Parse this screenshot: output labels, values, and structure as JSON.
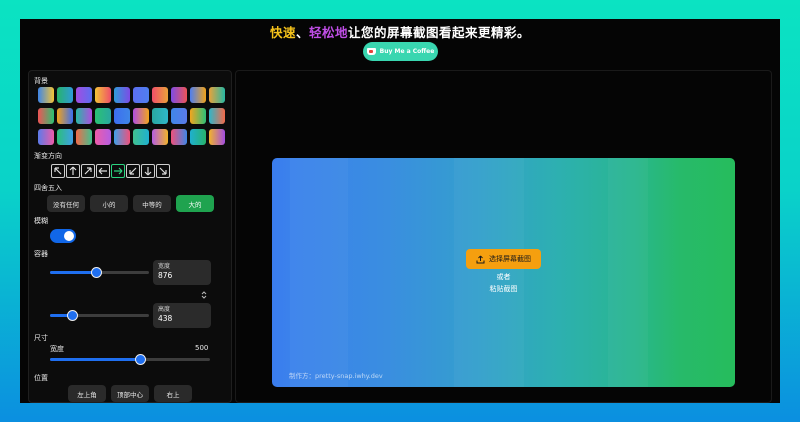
{
  "header": {
    "title_part1": "快速",
    "title_sep": "、",
    "title_part2": "轻松地",
    "title_rest": "让您的屏幕截图看起来更精彩。",
    "bmc_label": "Buy Me a Coffee"
  },
  "sidebar": {
    "background_label": "背景",
    "swatches": [
      "#3f86e7",
      "#27b36b",
      "#a34de2",
      "#f4c437",
      "#2f9bd9",
      "#5c6ef0",
      "#ef4f6a",
      "#7d4ce6",
      "#4f7ff0",
      "#e9a23a",
      "#ef5455",
      "#f1a31a",
      "#27b8a4",
      "#2ac273",
      "#3c6ef0",
      "#b04ee0",
      "#29a7a0",
      "#3f86e7",
      "#f2a51e",
      "#2fb6c9",
      "#5b7bea",
      "#2cbf78",
      "#f36a4a",
      "#ee5ca8",
      "#3fa0e8",
      "#40c18f",
      "#b45ee2",
      "#f0517b",
      "#1fb0d0",
      "#f1b32b"
    ],
    "direction_label": "渐变方向",
    "directions": [
      "↖",
      "↑",
      "↗",
      "←",
      "→",
      "↙",
      "↓",
      "↘"
    ],
    "rounding_label": "四舍五入",
    "rounding_options": [
      "没有任何",
      "小的",
      "中等的",
      "大的"
    ],
    "rounding_selected": "大的",
    "blur_label": "模糊",
    "blur_on": true,
    "container_label": "容器",
    "width_field_label": "宽度",
    "width_value": "876",
    "height_field_label": "高度",
    "height_value": "438",
    "size_label": "尺寸",
    "size_width_label": "宽度",
    "size_width_value": "500",
    "position_label": "位置",
    "position_options": [
      "左上角",
      "顶部中心",
      "右上"
    ]
  },
  "main": {
    "upload_label": "选择屏幕截图",
    "or_label": "或者",
    "paste_label": "粘贴截图",
    "credit": "制作方：pretty-snap.iwhy.dev"
  },
  "colors": {
    "accent_green": "#1fa34f",
    "accent_blue": "#1167e8",
    "upload_orange": "#f59f0f",
    "title_yellow": "#f6c31b",
    "title_purple": "#c04ee6"
  }
}
